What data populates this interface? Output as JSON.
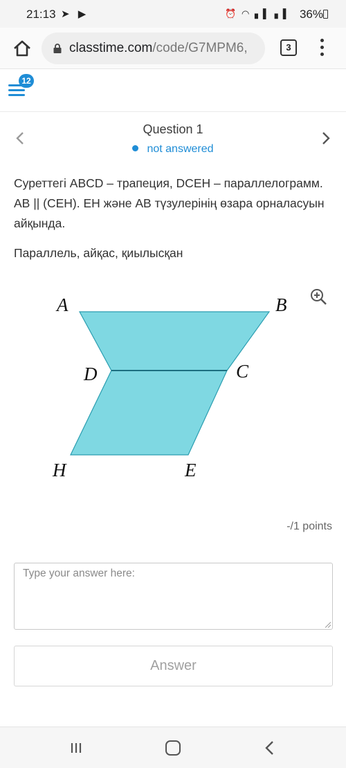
{
  "status_bar": {
    "time": "21:13",
    "left_icons": [
      "telegram-icon",
      "youtube-icon"
    ],
    "right_icons": [
      "alarm-icon",
      "wifi-icon",
      "signal-icon",
      "signal-icon"
    ],
    "battery": "36%"
  },
  "browser": {
    "url_domain": "classtime.com",
    "url_path": "/code/G7MPM6,",
    "tab_count": "3"
  },
  "header": {
    "notification_count": "12"
  },
  "question": {
    "title": "Question 1",
    "status": "not answered",
    "text": "Суреттегі ABCD – трапеция, DCEH – параллелограмм. AB || (CEH). EH және AB түзулерінің өзара орналасуын айқында.",
    "options": "Параллель, айқас, қиылысқан",
    "points": "-/1 points"
  },
  "figure": {
    "labels": {
      "A": "A",
      "B": "B",
      "C": "C",
      "D": "D",
      "E": "E",
      "H": "H"
    },
    "fill_color": "#7fd8e2",
    "stroke_color": "#2a9db0"
  },
  "answer": {
    "placeholder": "Type your answer here:",
    "button_label": "Answer"
  },
  "colors": {
    "accent": "#1f8dd6"
  }
}
